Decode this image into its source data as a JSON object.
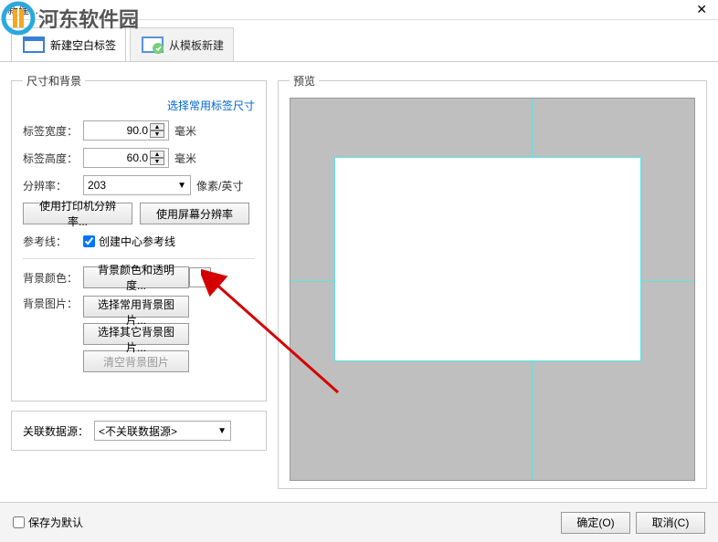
{
  "title": "新建...",
  "watermark": "河东软件园",
  "tabs": {
    "blank": "新建空白标签",
    "template": "从模板新建"
  },
  "sizeGroup": {
    "legend": "尺寸和背景",
    "commonSizeLink": "选择常用标签尺寸",
    "widthLabel": "标签宽度：",
    "widthValue": "90.0",
    "heightLabel": "标签高度：",
    "heightValue": "60.0",
    "unitMM": "毫米",
    "resLabel": "分辨率：",
    "resValue": "203",
    "resUnit": "像素/英寸",
    "usePrinterRes": "使用打印机分辨率...",
    "useScreenRes": "使用屏幕分辨率",
    "guideLabel": "参考线：",
    "guideCheck": "创建中心参考线",
    "bgColorLabel": "背景颜色：",
    "bgColorBtn": "背景颜色和透明度...",
    "bgImageLabel": "背景图片：",
    "bgImageCommon": "选择常用背景图片...",
    "bgImageOther": "选择其它背景图片...",
    "bgImageClear": "清空背景图片"
  },
  "dataSource": {
    "label": "关联数据源：",
    "value": "<不关联数据源>"
  },
  "preview": {
    "legend": "预览"
  },
  "footer": {
    "saveDefault": "保存为默认",
    "ok": "确定(O)",
    "cancel": "取消(C)"
  }
}
